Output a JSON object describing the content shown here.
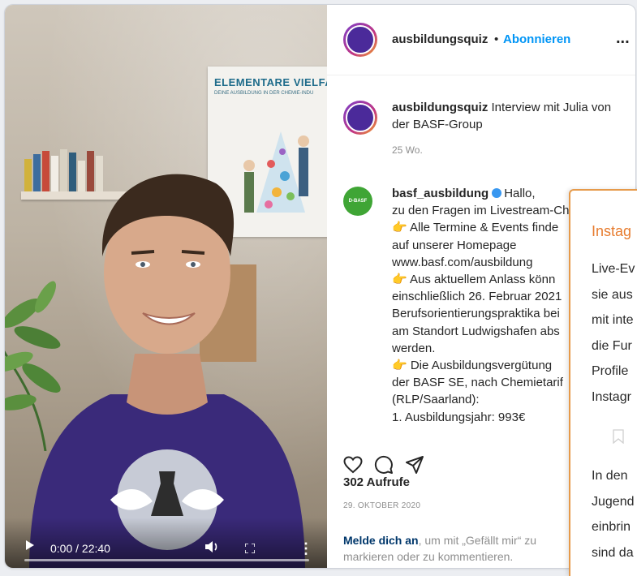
{
  "video": {
    "time": "0:00 / 22:40",
    "poster_title": "ELEMENTARE VIELFA",
    "poster_subtitle": "DEINE AUSBILDUNG IN DER CHEMIE-INDU"
  },
  "header": {
    "username": "ausbildungsquiz",
    "separator": "•",
    "follow_label": "Abonnieren",
    "more_label": "..."
  },
  "caption": {
    "username": "ausbildungsquiz",
    "text": "Interview mit Julia von der BASF-Group",
    "time": "25 Wo."
  },
  "comment": {
    "username": "basf_ausbildung",
    "avatar_text": "D-BASF",
    "lines": [
      "Hallo,",
      "zu den Fragen im Livestream-Chat:",
      "👉 Alle Termine & Events finde",
      "auf unserer Homepage",
      "www.basf.com/ausbildung",
      "👉 Aus aktuellem Anlass könn",
      "einschließlich 26. Februar 2021",
      "Berufsorientierungspraktika bei",
      "am Standort Ludwigshafen abs",
      "werden.",
      "👉 Die Ausbildungsvergütung",
      "der BASF SE, nach Chemietarif",
      "(RLP/Saarland):",
      "1. Ausbildungsjahr: 993€"
    ]
  },
  "actions": {
    "like_icon": "heart-icon",
    "comment_icon": "comment-icon",
    "share_icon": "share-icon"
  },
  "stats": {
    "views": "302 Aufrufe",
    "date": "29. OKTOBER 2020"
  },
  "login": {
    "link": "Melde dich an",
    "text": ", um mit „Gefällt mir“ zu markieren oder zu kommentieren."
  },
  "overlay": {
    "title": "Instag",
    "lines": [
      "Live-Ev",
      "sie aus",
      "mit inte",
      "die Fur",
      "Profile",
      "Instagr"
    ],
    "lines2": [
      "In den",
      "Jugend",
      "einbrin",
      "sind da"
    ]
  },
  "colors": {
    "follow": "#0095f6",
    "basf_green": "#3fa535",
    "accent_orange": "#e77c2f"
  }
}
